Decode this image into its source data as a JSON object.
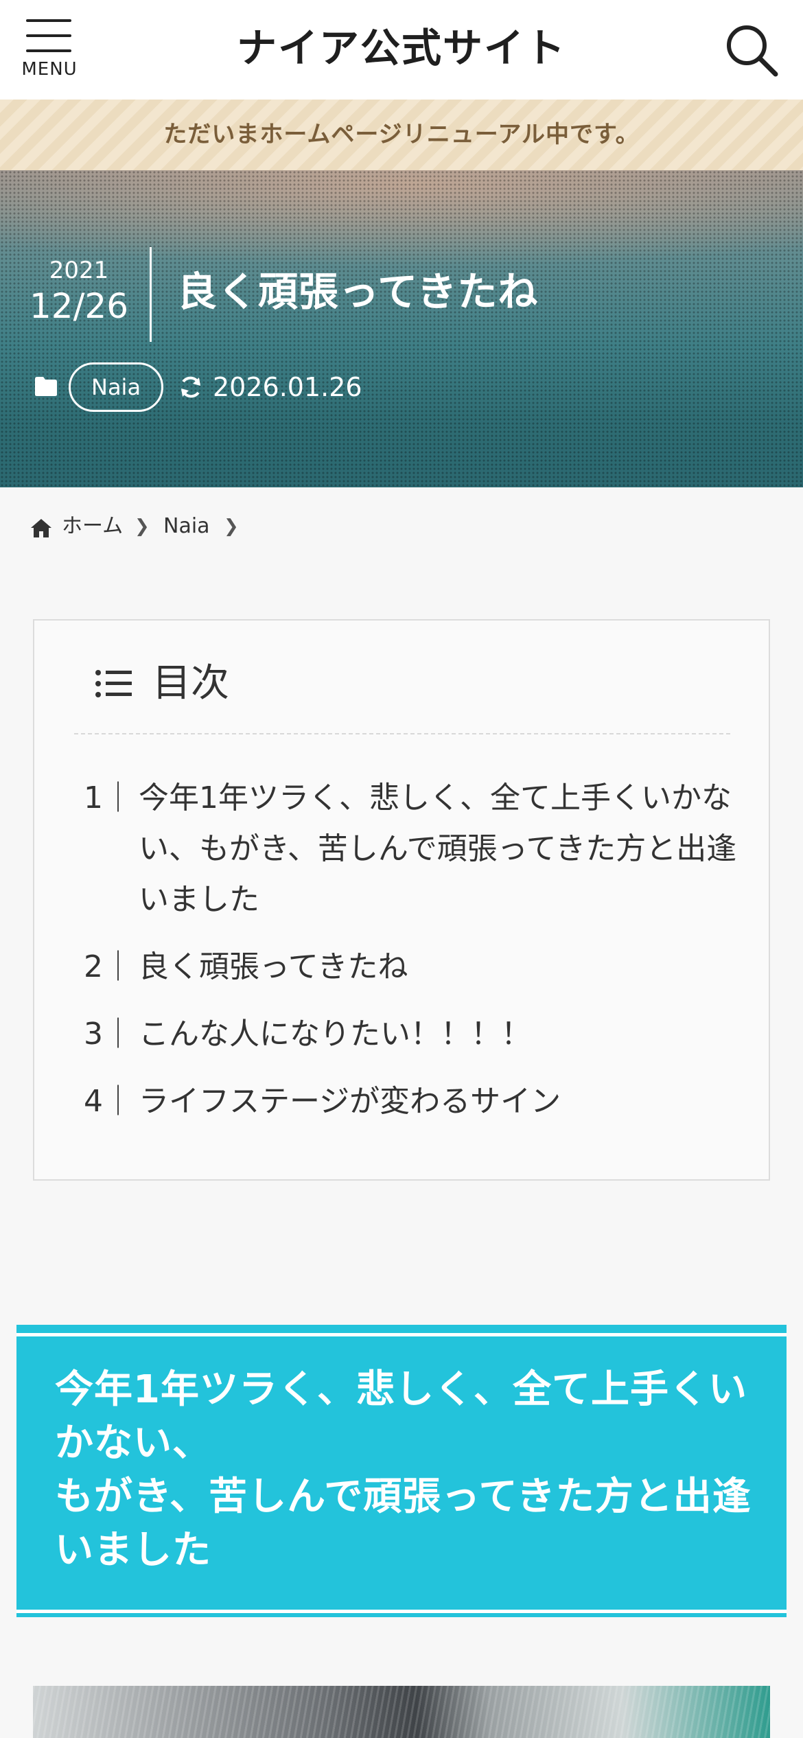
{
  "header": {
    "menu_label": "MENU",
    "site_title": "ナイア公式サイト"
  },
  "notice": {
    "text": "ただいまホームページリニューアル中です。"
  },
  "post": {
    "year": "2021",
    "month_day": "12/26",
    "title": "良く頑張ってきたね",
    "category": "Naia",
    "updated": "2026.01.26"
  },
  "breadcrumb": {
    "home": "ホーム",
    "category": "Naia",
    "separator": "❯"
  },
  "toc": {
    "title": "目次",
    "items": [
      {
        "num": "1｜",
        "label": "今年1年ツラく、悲しく、全て上手くいかない、もがき、苦しんで頑張ってきた方と出逢いました"
      },
      {
        "num": "2｜",
        "label": "良く頑張ってきたね"
      },
      {
        "num": "3｜",
        "label": "こんな人になりたい！！！！"
      },
      {
        "num": "4｜",
        "label": "ライフステージが変わるサイン"
      }
    ]
  },
  "section": {
    "heading_line1": "今年1年ツラく、悲しく、全て上手くいかない、",
    "heading_line2": "もがき、苦しんで頑張ってきた方と出逢いました"
  },
  "colors": {
    "accent": "#23c3db",
    "notice_text": "#7a5e3a"
  }
}
